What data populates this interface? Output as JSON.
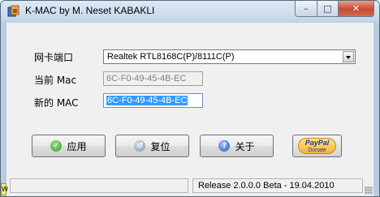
{
  "window": {
    "title": "K-MAC by M. Neset KABAKLI",
    "minimize_glyph": "–",
    "maximize_glyph": "□",
    "close_glyph": "✕"
  },
  "form": {
    "adapter_label": "网卡端口",
    "adapter_value": "Realtek RTL8168C(P)/8111C(P)",
    "current_mac_label": "当前 Mac",
    "current_mac_value": "6C-F0-49-45-4B-EC",
    "new_mac_label": "新的 MAC",
    "new_mac_value": "6C-F0-49-45-4B-EC"
  },
  "buttons": {
    "apply": "应用",
    "reset": "复位",
    "about": "关于",
    "paypal_logo": "PayPal",
    "paypal_donate": "Donate"
  },
  "icons": {
    "apply": "check-icon",
    "reset": "reset-icon",
    "about": "info-icon"
  },
  "status": {
    "release": "Release 2.0.0.0 Beta - 19.04.2010"
  },
  "corner_glyph": "W"
}
